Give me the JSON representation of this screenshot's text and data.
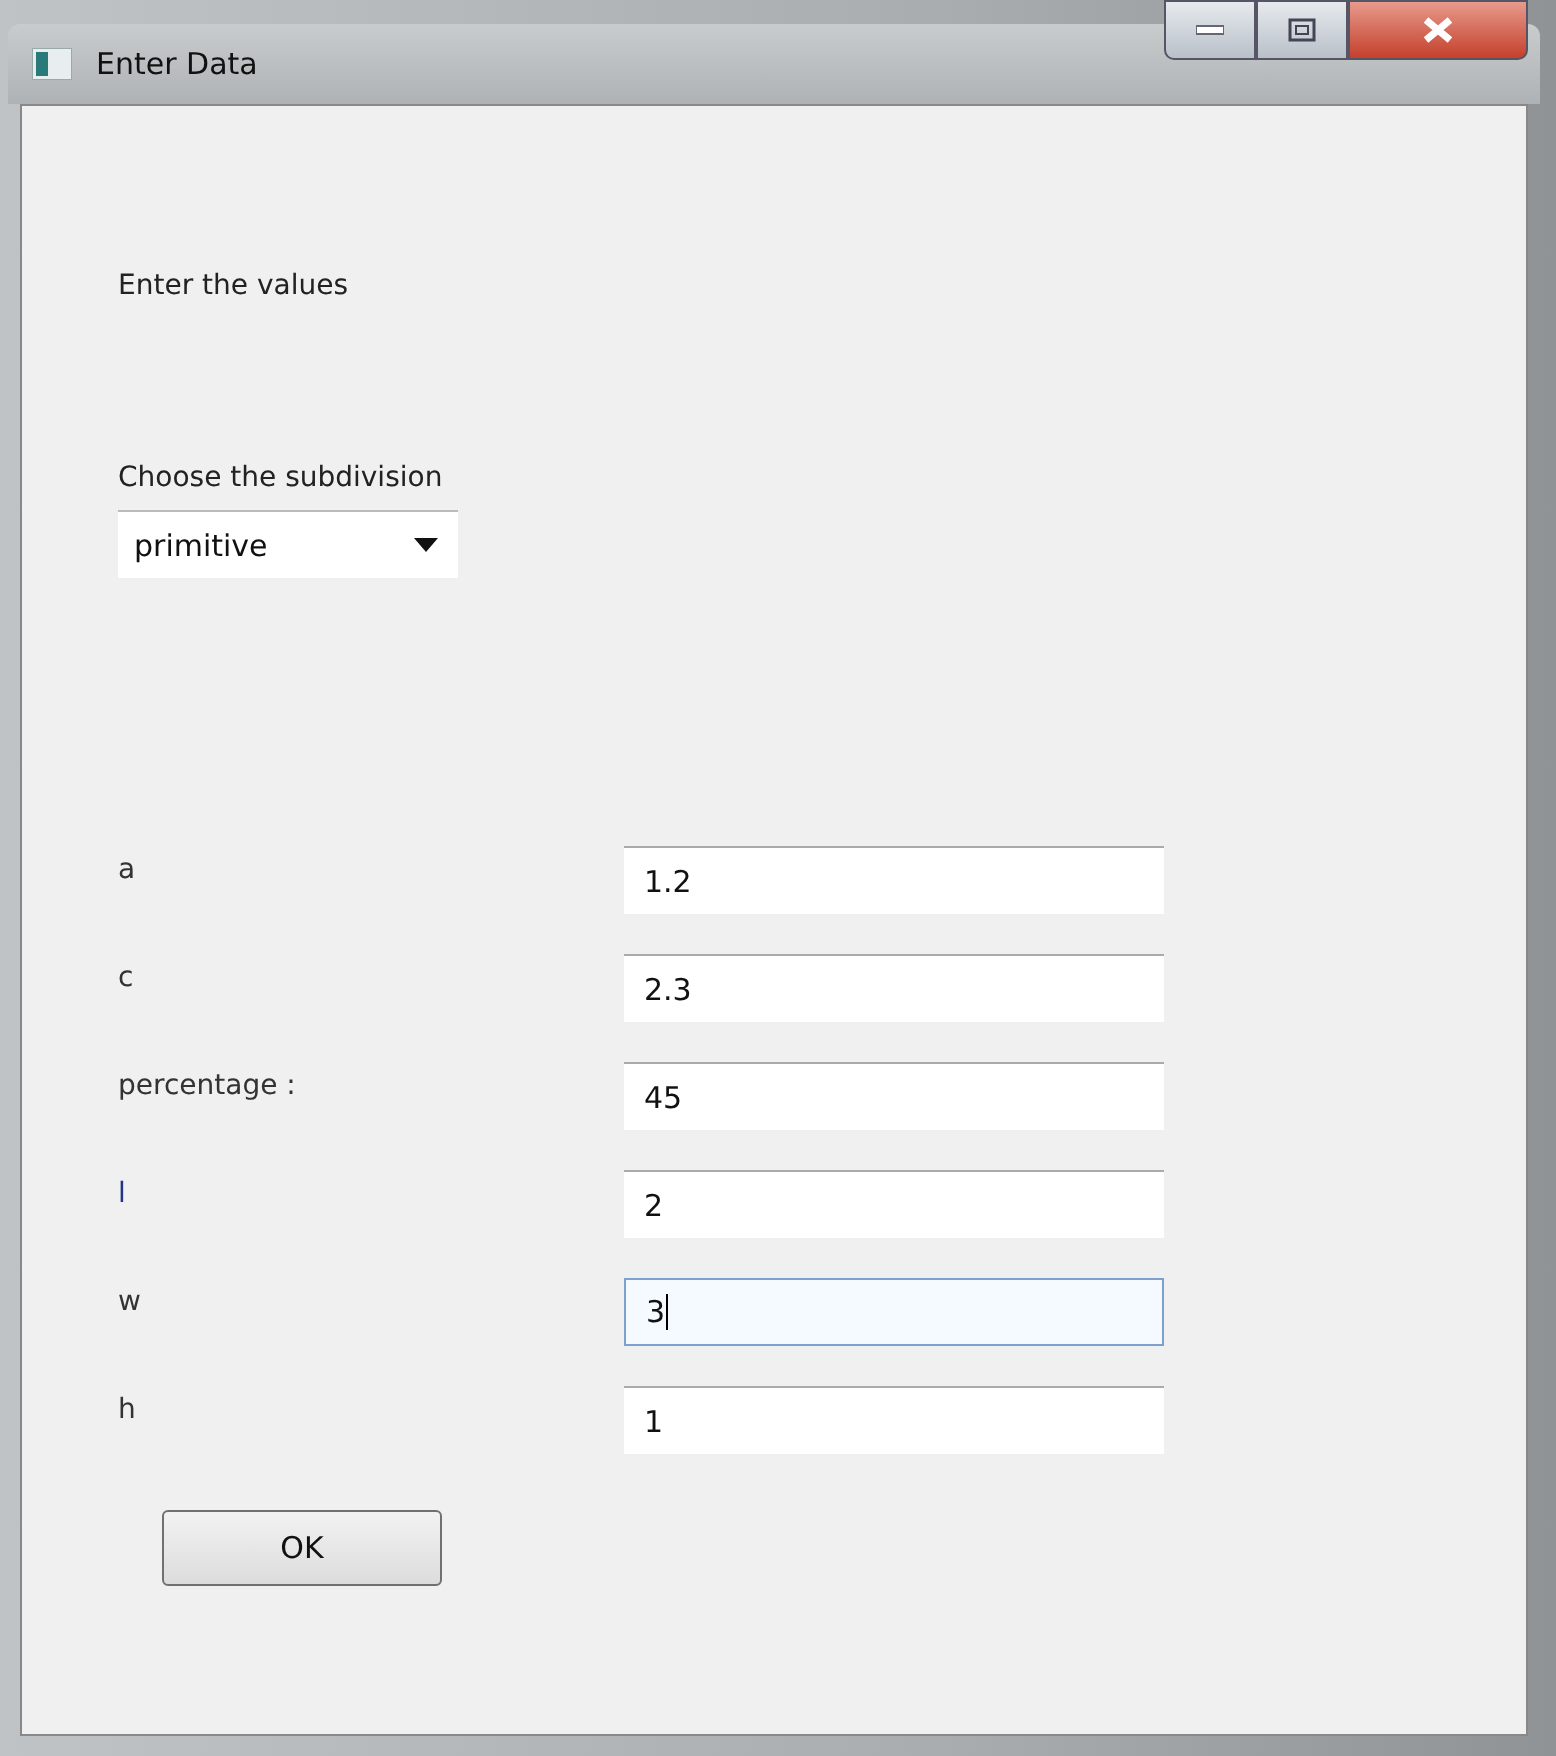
{
  "window": {
    "title": "Enter Data"
  },
  "heading": "Enter the values",
  "subdivision": {
    "label": "Choose the subdivision",
    "value": "primitive"
  },
  "fields": [
    {
      "label": "a",
      "value": "1.2",
      "focused": false
    },
    {
      "label": "c",
      "value": "2.3",
      "focused": false
    },
    {
      "label": "percentage :",
      "value": "45",
      "focused": false
    },
    {
      "label": "l",
      "value": "2",
      "focused": false
    },
    {
      "label": "w",
      "value": "3",
      "focused": true
    },
    {
      "label": "h",
      "value": "1",
      "focused": false
    }
  ],
  "buttons": [
    "OK"
  ]
}
